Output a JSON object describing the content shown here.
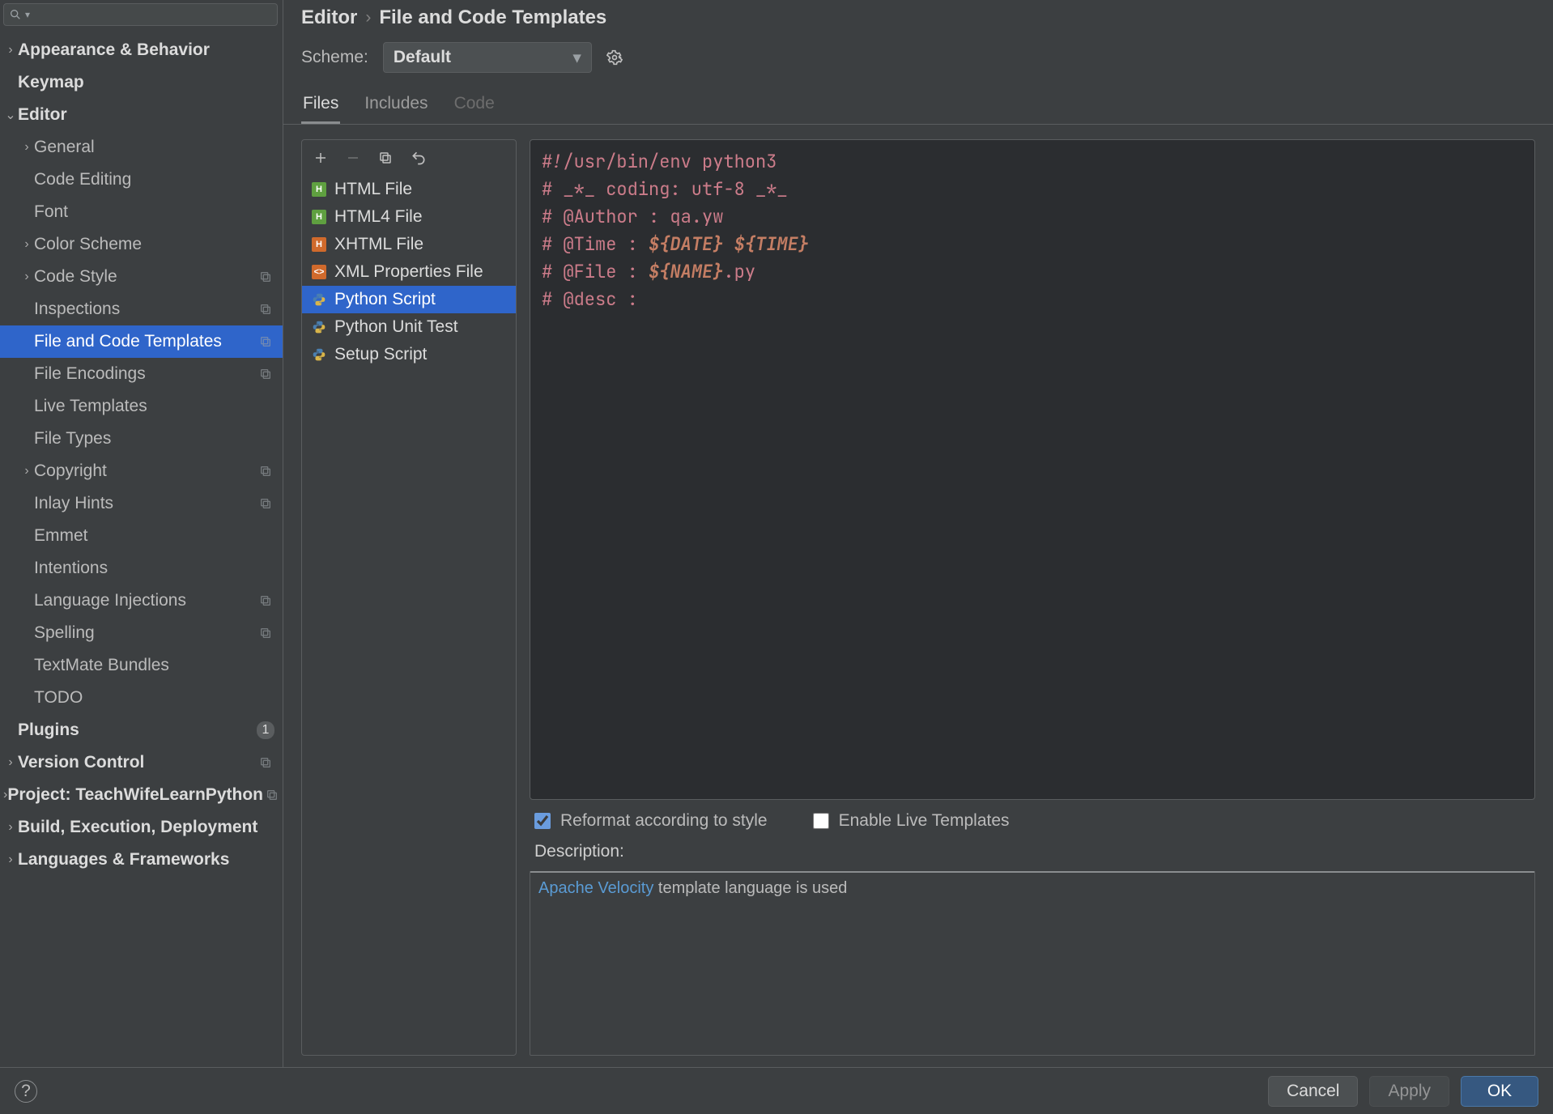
{
  "search": {
    "placeholder": ""
  },
  "sidebar": {
    "items": [
      {
        "label": "Appearance & Behavior",
        "expandable": true,
        "expanded": false,
        "bold": true,
        "lvl": 0
      },
      {
        "label": "Keymap",
        "bold": true,
        "lvl": 0
      },
      {
        "label": "Editor",
        "expandable": true,
        "expanded": true,
        "bold": true,
        "lvl": 0
      },
      {
        "label": "General",
        "expandable": true,
        "expanded": false,
        "lvl": 1
      },
      {
        "label": "Code Editing",
        "lvl": 1
      },
      {
        "label": "Font",
        "lvl": 1
      },
      {
        "label": "Color Scheme",
        "expandable": true,
        "expanded": false,
        "lvl": 1
      },
      {
        "label": "Code Style",
        "expandable": true,
        "expanded": false,
        "lvl": 1,
        "copy": true
      },
      {
        "label": "Inspections",
        "lvl": 1,
        "copy": true
      },
      {
        "label": "File and Code Templates",
        "lvl": 1,
        "copy": true,
        "selected": true
      },
      {
        "label": "File Encodings",
        "lvl": 1,
        "copy": true
      },
      {
        "label": "Live Templates",
        "lvl": 1
      },
      {
        "label": "File Types",
        "lvl": 1
      },
      {
        "label": "Copyright",
        "expandable": true,
        "expanded": false,
        "lvl": 1,
        "copy": true
      },
      {
        "label": "Inlay Hints",
        "lvl": 1,
        "copy": true
      },
      {
        "label": "Emmet",
        "lvl": 1
      },
      {
        "label": "Intentions",
        "lvl": 1
      },
      {
        "label": "Language Injections",
        "lvl": 1,
        "copy": true
      },
      {
        "label": "Spelling",
        "lvl": 1,
        "copy": true
      },
      {
        "label": "TextMate Bundles",
        "lvl": 1
      },
      {
        "label": "TODO",
        "lvl": 1
      },
      {
        "label": "Plugins",
        "bold": true,
        "lvl": 0,
        "badge": "1"
      },
      {
        "label": "Version Control",
        "expandable": true,
        "expanded": false,
        "bold": true,
        "lvl": 0,
        "copy": true
      },
      {
        "label": "Project: TeachWifeLearnPython",
        "expandable": true,
        "expanded": false,
        "bold": true,
        "lvl": 0,
        "copy": true
      },
      {
        "label": "Build, Execution, Deployment",
        "expandable": true,
        "expanded": false,
        "bold": true,
        "lvl": 0
      },
      {
        "label": "Languages & Frameworks",
        "expandable": true,
        "expanded": false,
        "bold": true,
        "lvl": 0
      }
    ]
  },
  "breadcrumb": {
    "root": "Editor",
    "leaf": "File and Code Templates"
  },
  "scheme": {
    "label": "Scheme:",
    "value": "Default"
  },
  "tabs": {
    "items": [
      {
        "label": "Files",
        "active": true
      },
      {
        "label": "Includes"
      },
      {
        "label": "Code",
        "disabled": true
      }
    ]
  },
  "templates": {
    "items": [
      {
        "label": "HTML File",
        "kind": "html"
      },
      {
        "label": "HTML4 File",
        "kind": "html"
      },
      {
        "label": "XHTML File",
        "kind": "xhtml"
      },
      {
        "label": "XML Properties File",
        "kind": "xml"
      },
      {
        "label": "Python Script",
        "kind": "py",
        "selected": true
      },
      {
        "label": "Python Unit Test",
        "kind": "py"
      },
      {
        "label": "Setup Script",
        "kind": "py"
      }
    ]
  },
  "code": {
    "l1": "#!/usr/bin/env python3",
    "l2": "# _*_ coding: utf-8 _*_",
    "l3": "# @Author : qa.yw",
    "l4a": "# @Time : ",
    "l4b": "${DATE} ${TIME}",
    "l5a": "# @File : ",
    "l5b": "${NAME}",
    "l5c": ".py",
    "l6": "# @desc : "
  },
  "options": {
    "reformat": {
      "label": "Reformat according to style",
      "checked": true
    },
    "live": {
      "label": "Enable Live Templates",
      "checked": false
    }
  },
  "description": {
    "label": "Description:",
    "link": "Apache Velocity",
    "rest": " template language is used"
  },
  "buttons": {
    "help": "?",
    "cancel": "Cancel",
    "apply": "Apply",
    "ok": "OK"
  }
}
